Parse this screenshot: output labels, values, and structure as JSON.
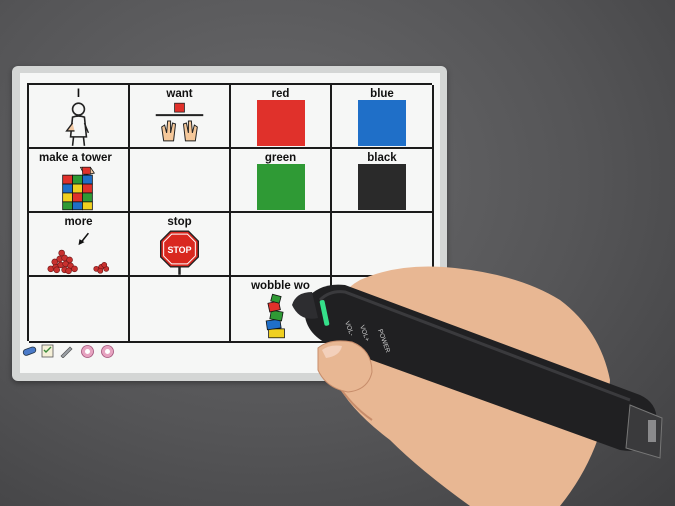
{
  "board": {
    "cells": [
      {
        "label": "I"
      },
      {
        "label": "want"
      },
      {
        "label": "red"
      },
      {
        "label": "blue"
      },
      {
        "label": "make a tower"
      },
      {
        "label": ""
      },
      {
        "label": "green"
      },
      {
        "label": "black"
      },
      {
        "label": "more"
      },
      {
        "label": "stop"
      },
      {
        "label": ""
      },
      {
        "label": ""
      },
      {
        "label": ""
      },
      {
        "label": ""
      },
      {
        "label": "wobble wo"
      },
      {
        "label": ""
      }
    ],
    "stop_sign_text": "STOP",
    "colors": {
      "red": "#e0312b",
      "blue": "#1f6fc8",
      "green": "#2f9a35",
      "black": "#2a2a2a"
    }
  },
  "pen": {
    "labels": {
      "vol_minus": "VOL-",
      "vol_plus": "VOL+",
      "power": "POWER"
    },
    "led_color": "#35e08a"
  },
  "toolbar": {
    "icons": [
      "pen-icon",
      "checklist-icon",
      "pencil-icon",
      "record-icon",
      "record-icon"
    ]
  }
}
